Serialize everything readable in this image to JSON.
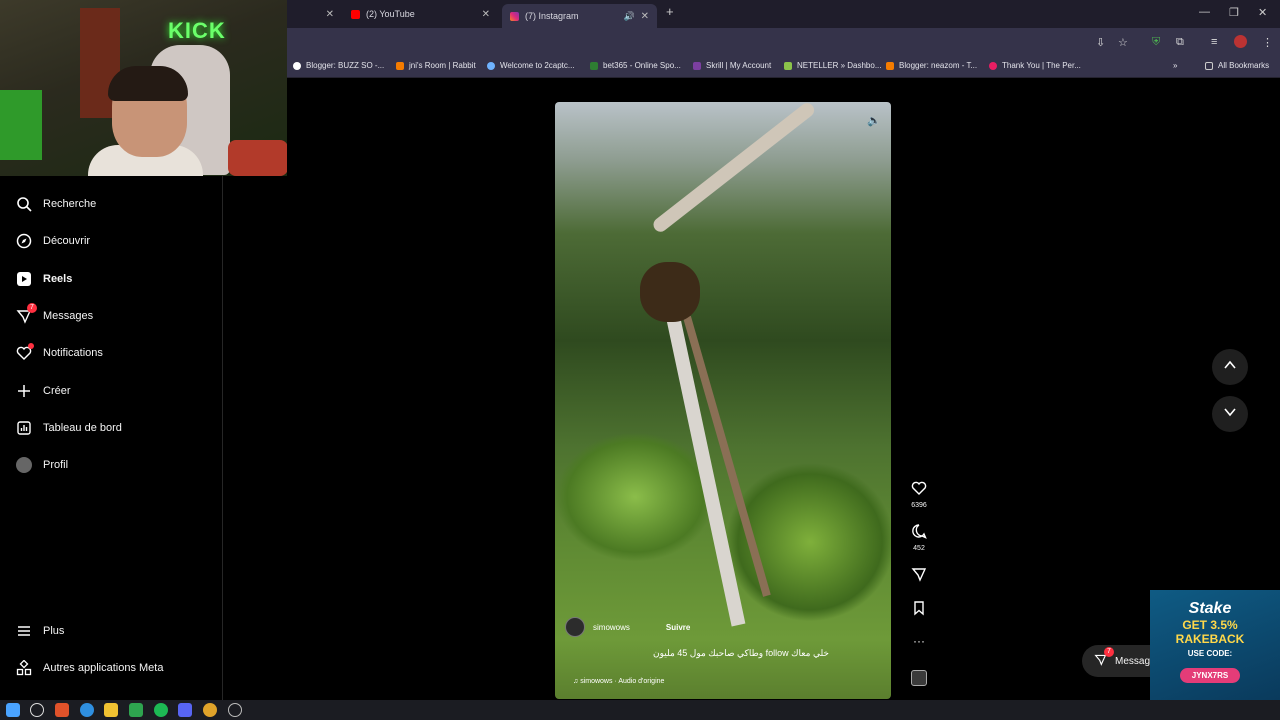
{
  "browser": {
    "tabs": [
      {
        "title": "(2) YouTube"
      },
      {
        "title": "(7) Instagram"
      }
    ],
    "new_tab": "+",
    "bookmarks": [
      {
        "label": "Blogger: BUZZ SO -...",
        "color": "#ffffff"
      },
      {
        "label": "jni's Room | Rabbit",
        "color": "#f57c00"
      },
      {
        "label": "Welcome to 2captc...",
        "color": "#6fb3ff"
      },
      {
        "label": "bet365 - Online Spo...",
        "color": "#2e7d32"
      },
      {
        "label": "Skrill | My Account",
        "color": "#7b3fa0"
      },
      {
        "label": "NETELLER » Dashbo...",
        "color": "#8bc34a"
      },
      {
        "label": "Blogger: neazom - T...",
        "color": "#f57c00"
      },
      {
        "label": "Thank You | The Per...",
        "color": "#e91e63"
      }
    ],
    "more_bookmarks": "»",
    "all_bookmarks": "All Bookmarks"
  },
  "webcam": {
    "neon_text": "KICK"
  },
  "sidebar": {
    "items": [
      {
        "label": "Recherche"
      },
      {
        "label": "Découvrir"
      },
      {
        "label": "Reels"
      },
      {
        "label": "Messages",
        "badge": "7"
      },
      {
        "label": "Notifications"
      },
      {
        "label": "Créer"
      },
      {
        "label": "Tableau de bord"
      },
      {
        "label": "Profil"
      }
    ],
    "more": "Plus",
    "meta_apps": "Autres applications Meta"
  },
  "reel": {
    "username": "simowows",
    "follow": "Suivre",
    "caption": "خلي معاك follow وطاكي صاحبك مول 45 مليون",
    "audio": "simowows · Audio d'origine",
    "likes": "6396",
    "comments": "452"
  },
  "messages_pill": {
    "label": "Messages",
    "badge": "7"
  },
  "ad": {
    "brand": "Stake",
    "line1": "GET 3.5%",
    "line2": "RAKEBACK",
    "line3": "USE CODE:",
    "code": "JYNX7RS"
  },
  "colors": {
    "accent_red": "#ff3040",
    "ad_code": "#e43c78",
    "ad_yellow": "#ffd84a"
  }
}
